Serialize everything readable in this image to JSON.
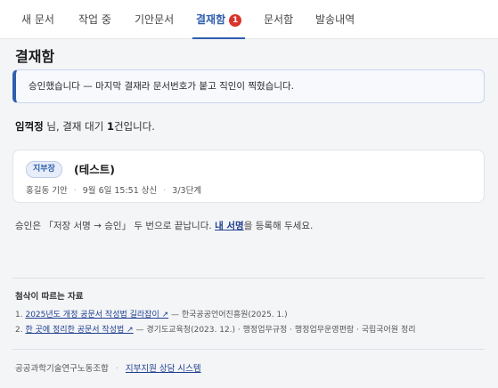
{
  "tabs": [
    {
      "label": "새 문서"
    },
    {
      "label": "작업 중"
    },
    {
      "label": "기안문서"
    },
    {
      "label": "결재함",
      "badge": "1"
    },
    {
      "label": "문서함"
    },
    {
      "label": "발송내역"
    }
  ],
  "colors": {
    "accent": "#2f5fae",
    "badge": "#d9342b",
    "link": "#1f3f8f"
  },
  "page_title": "결재함",
  "notice": "승인했습니다 — 마지막 결재라 문서번호가 붙고 직인이 찍혔습니다.",
  "summary": {
    "user": "임꺽정",
    "text_a": " 님, 결재 대기 ",
    "count": "1",
    "text_b": "건입니다."
  },
  "doc": {
    "dept": "지부장",
    "title": "(테스트)",
    "drafter": "홍길동 기안",
    "submitted": "9월 6일 15:51 상신",
    "step": "3/3단계"
  },
  "hint": {
    "pre": "승인은 「저장 서명 → 승인」 두 번으로 끝납니다. ",
    "link": "내 서명",
    "post": "을 등록해 두세요."
  },
  "refs": {
    "title": "첨삭이 따르는 자료",
    "items": [
      {
        "num": "1.",
        "link": "2025년도 개정 공문서 작성법 길라잡이 ↗",
        "rest": " — 한국공공언어진흥원(2025. 1.)"
      },
      {
        "num": "2.",
        "link": "한 곳에 정리한 공문서 작성법 ↗",
        "rest": " — 경기도교육청(2023. 12.) · 행정업무규정 · 행정업무운영편람 · 국립국어원 정리"
      }
    ]
  },
  "footer": {
    "org": "공공과학기술연구노동조합",
    "sep": "·",
    "link": "지부지원 상담 시스템"
  }
}
